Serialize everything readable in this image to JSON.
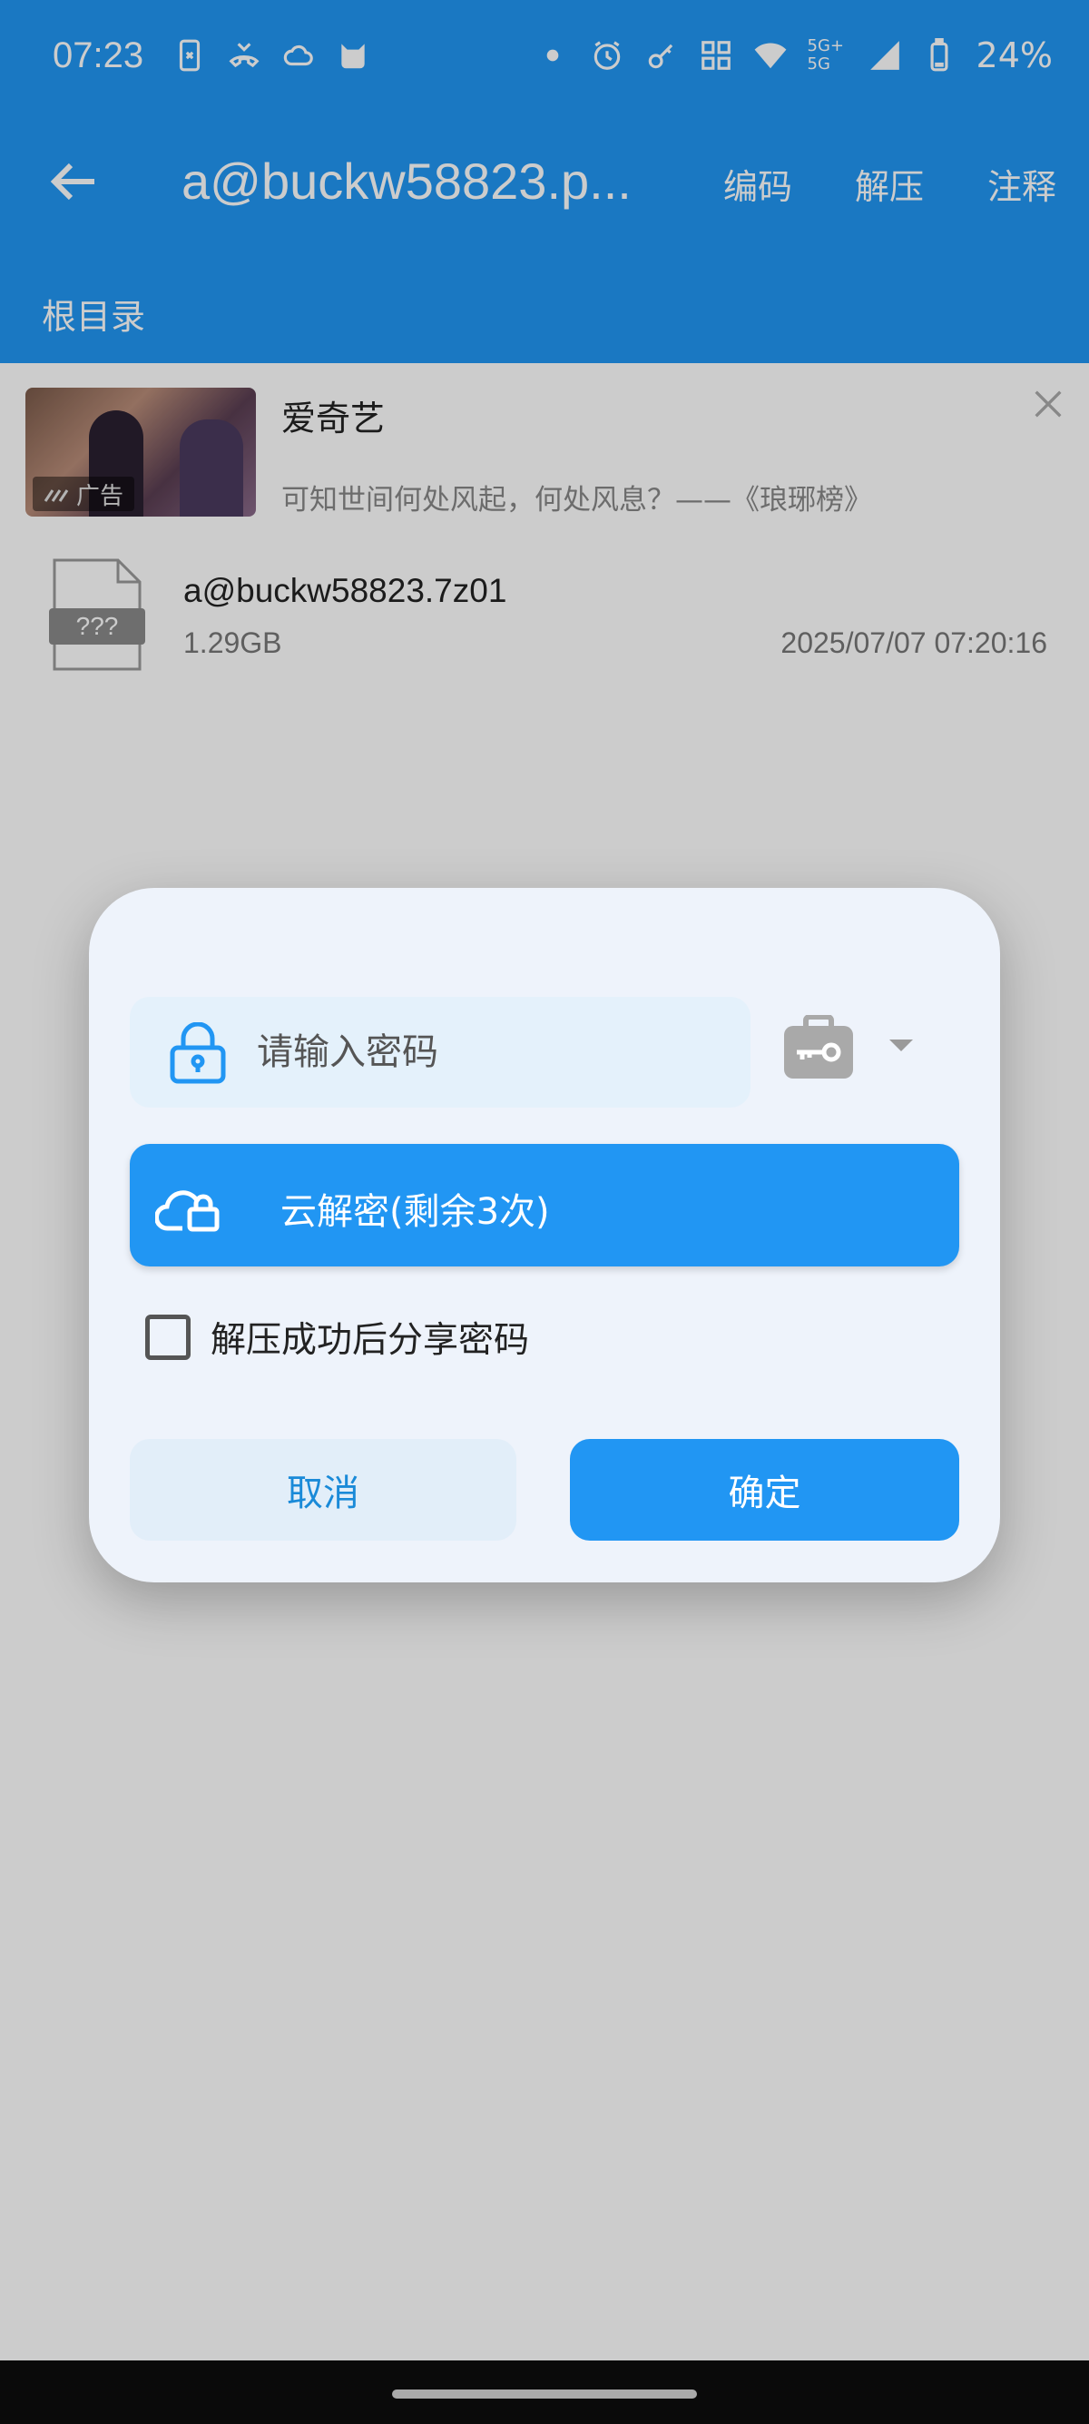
{
  "status_bar": {
    "time": "07:23",
    "battery": "24%",
    "network": "5G+ 5G",
    "left_icons": [
      "phone-link-icon",
      "missed-call-icon",
      "cloud-icon",
      "cat-app-icon"
    ],
    "right_icons": [
      "dot-icon",
      "alarm-icon",
      "key-icon",
      "nfc-icon",
      "wifi-icon",
      "signal-icon",
      "battery-icon"
    ]
  },
  "toolbar": {
    "title": "a@buckw58823.p...",
    "actions": [
      "编码",
      "解压",
      "注释"
    ]
  },
  "breadcrumb": "根目录",
  "ad": {
    "title": "爱奇艺",
    "subtitle": "可知世间何处风起，何处风息？——《琅琊榜》",
    "tag": "广告"
  },
  "file": {
    "name": "a@buckw58823.7z01",
    "size": "1.29GB",
    "date": "2025/07/07 07:20:16",
    "icon_label": "???"
  },
  "dialog": {
    "password_placeholder": "请输入密码",
    "cloud_button": "云解密(剩余3次)",
    "checkbox_label": "解压成功后分享密码",
    "cancel": "取消",
    "ok": "确定"
  },
  "colors": {
    "primary": "#2196f3",
    "dialog_bg": "#eef3fb",
    "field_bg": "#e4f1fb"
  }
}
